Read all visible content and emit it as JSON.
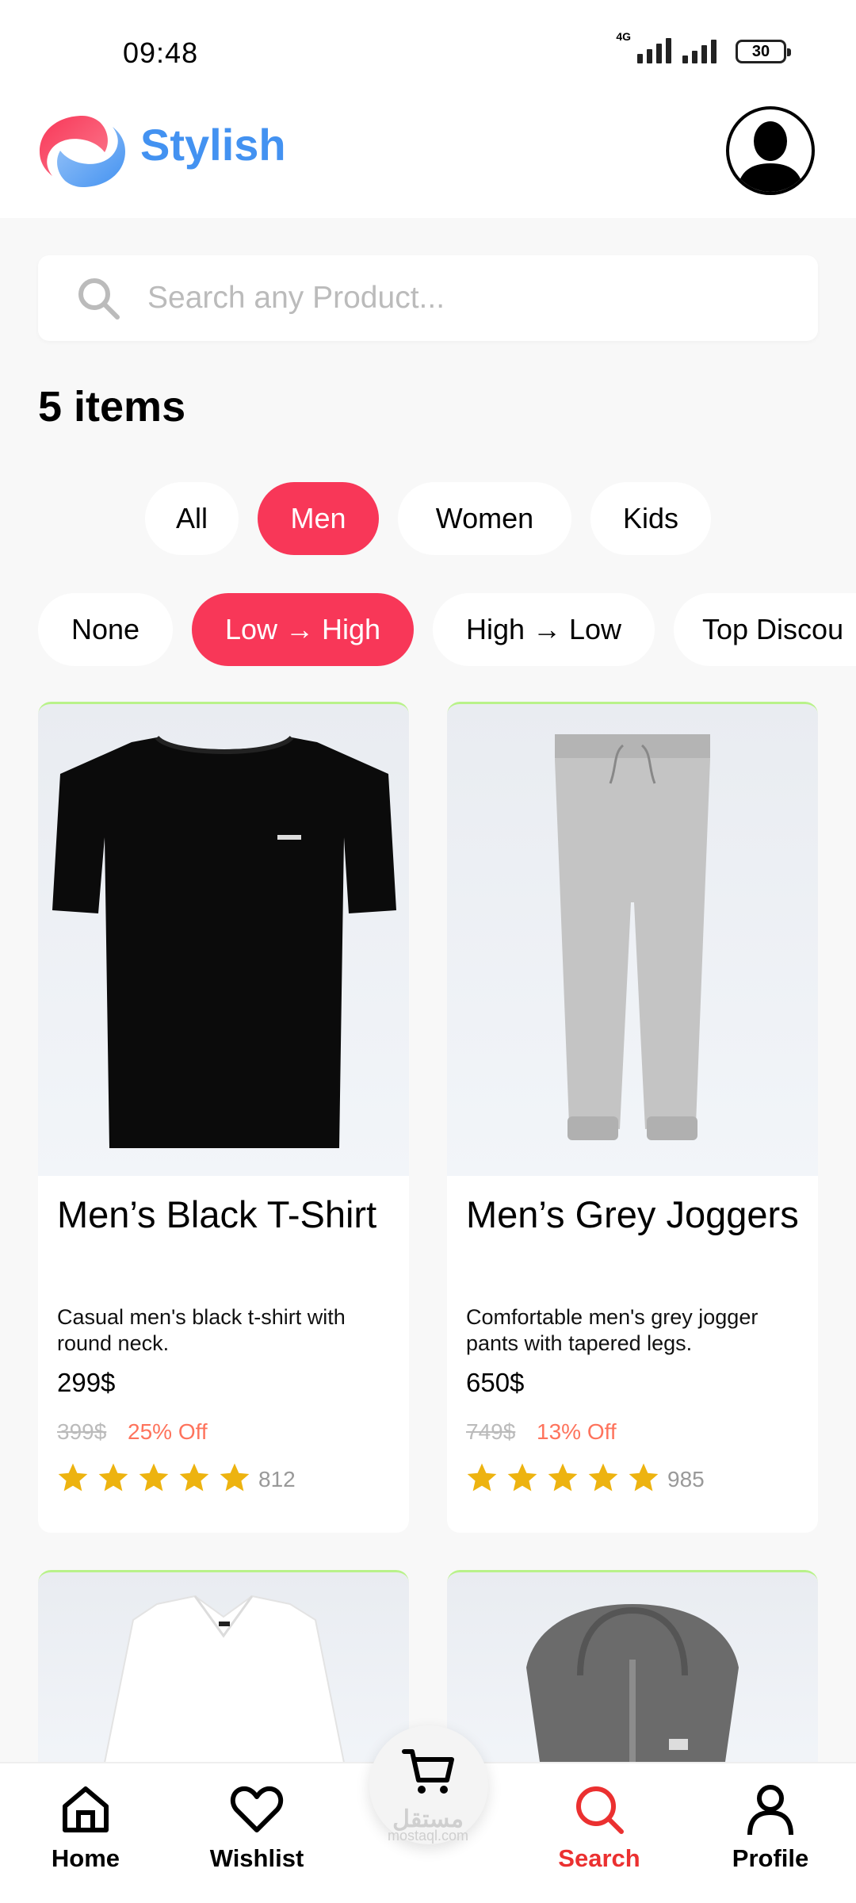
{
  "status_bar": {
    "time": "09:48",
    "network": "4G",
    "battery": "30"
  },
  "header": {
    "app_title": "Stylish"
  },
  "search": {
    "placeholder": "Search any Product..."
  },
  "results": {
    "count_label": "5 items"
  },
  "category_filters": [
    {
      "label": "All",
      "active": false
    },
    {
      "label": "Men",
      "active": true
    },
    {
      "label": "Women",
      "active": false
    },
    {
      "label": "Kids",
      "active": false
    }
  ],
  "sort_filters": [
    {
      "label": "None",
      "active": false
    },
    {
      "label": "Low → High",
      "active": true
    },
    {
      "label": "High → Low",
      "active": false
    },
    {
      "label": "Top Discou",
      "active": false
    }
  ],
  "products": [
    {
      "title": "Men’s Black T-Shirt",
      "description": "Casual men's black t-shirt with round neck.",
      "price": "299$",
      "old_price": "399$",
      "discount": "25% Off",
      "rating_count": "812",
      "stars": 5
    },
    {
      "title": "Men’s Grey Joggers",
      "description": "Comfortable men's grey jogger pants with tapered legs.",
      "price": "650$",
      "old_price": "749$",
      "discount": "13% Off",
      "rating_count": "985",
      "stars": 5
    }
  ],
  "bottom_nav": [
    {
      "label": "Home",
      "icon": "home-icon",
      "active": false
    },
    {
      "label": "Wishlist",
      "icon": "heart-icon",
      "active": false
    },
    {
      "label": "Search",
      "icon": "search-icon",
      "active": true
    },
    {
      "label": "Profile",
      "icon": "profile-icon",
      "active": false
    }
  ],
  "watermark": {
    "arabic": "مستقل",
    "latin": "mostaql.com"
  },
  "colors": {
    "accent": "#f83758",
    "brand_blue": "#4392f1",
    "discount": "#fe735c",
    "star": "#edb310",
    "nav_active": "#eb3030"
  }
}
